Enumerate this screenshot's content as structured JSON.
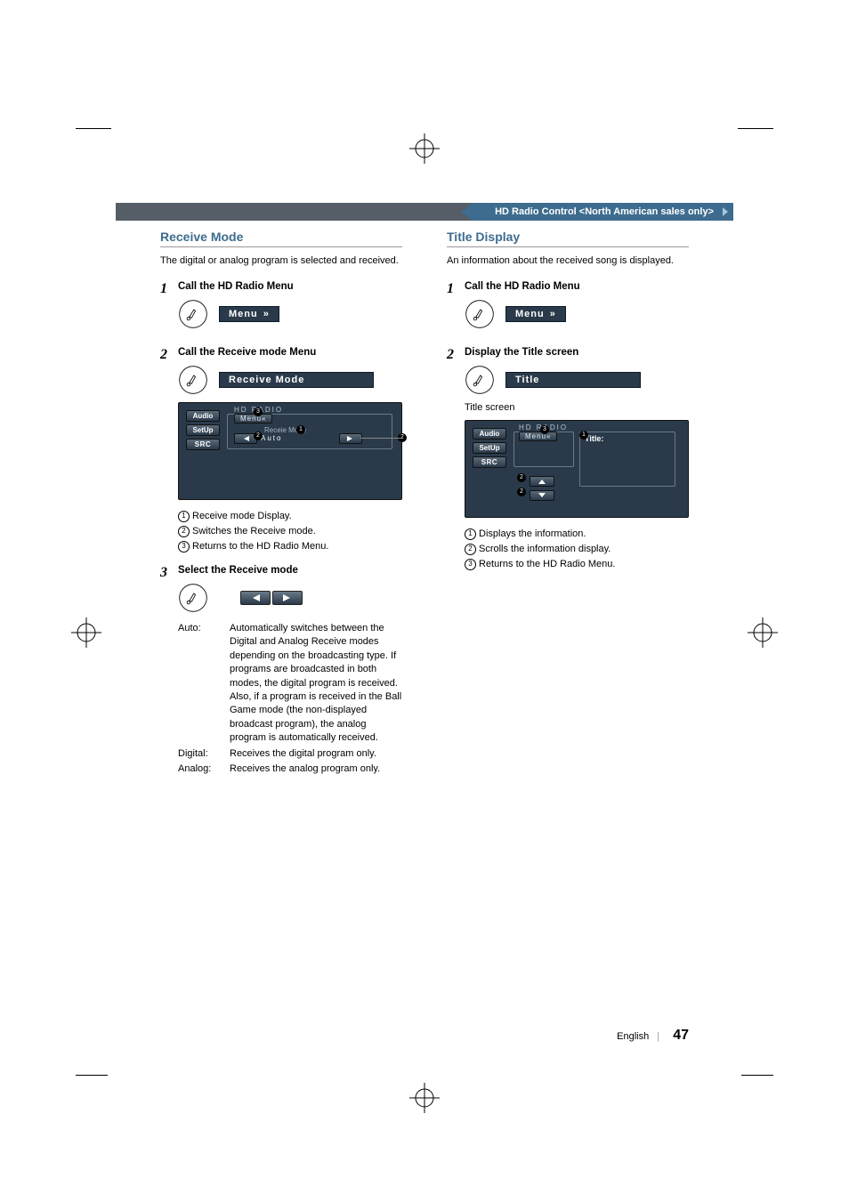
{
  "banner": {
    "tab": "HD Radio Control <North American sales only>"
  },
  "shared": {
    "menu_btn": "Menu",
    "screen_side": {
      "audio": "Audio",
      "setup": "SetUp",
      "src": "SRC"
    },
    "screen_frame_label": "HD RADIO",
    "screen_menu_pill": "Menu"
  },
  "left": {
    "title": "Receive Mode",
    "intro": "The digital or analog program is selected and received.",
    "steps": {
      "s1": {
        "num": "1",
        "title": "Call the HD Radio Menu"
      },
      "s2": {
        "num": "2",
        "title": "Call the Receive mode Menu",
        "btn_label": "Receive Mode",
        "screen_mode_label": "Receie Mode",
        "screen_mode_value": "Auto",
        "callouts": {
          "c1": "Receive mode Display.",
          "c2": "Switches the Receive mode.",
          "c3": "Returns to the HD Radio Menu."
        }
      },
      "s3": {
        "num": "3",
        "title": "Select the Receive mode",
        "modes": {
          "auto": {
            "key": "Auto:",
            "desc": "Automatically switches between the Digital and Analog Receive modes depending on the broadcasting type. If programs are broadcasted in both modes, the digital program is received. Also, if a program is received in the Ball Game mode (the non-displayed broadcast program), the analog program is automatically received."
          },
          "digital": {
            "key": "Digital:",
            "desc": "Receives the digital program only."
          },
          "analog": {
            "key": "Analog:",
            "desc": "Receives the analog program only."
          }
        }
      }
    }
  },
  "right": {
    "title": "Title Display",
    "intro": "An information about the received song is displayed.",
    "steps": {
      "s1": {
        "num": "1",
        "title": "Call the HD Radio Menu"
      },
      "s2": {
        "num": "2",
        "title": "Display the Title screen",
        "btn_label": "Title",
        "caption": "Title screen",
        "info_label": "Title:",
        "callouts": {
          "c1": "Displays the information.",
          "c2": "Scrolls the information display.",
          "c3": "Returns to the HD Radio Menu."
        }
      }
    }
  },
  "footer": {
    "lang": "English",
    "page": "47"
  }
}
